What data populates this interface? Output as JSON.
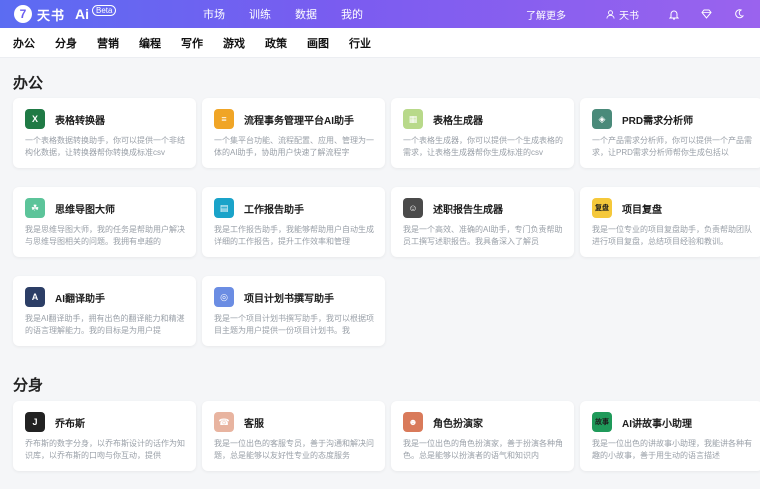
{
  "brand": {
    "mark": "7",
    "name": "天书",
    "ai": "Ai",
    "beta": "Beta"
  },
  "topnav": [
    "市场",
    "训练",
    "数据",
    "我的"
  ],
  "header": {
    "learn_more": "了解更多",
    "user": "天书"
  },
  "categories": [
    "办公",
    "分身",
    "营销",
    "编程",
    "写作",
    "游戏",
    "政策",
    "画图",
    "行业"
  ],
  "sections": [
    {
      "title": "办公",
      "cards": [
        {
          "name": "表格转换器",
          "desc": "一个表格数据转换助手，你可以提供一个非结构化数据，让转换器帮你转换成标准csv",
          "icon": "excel-icon",
          "color": "#1f7a45",
          "glyph": "X"
        },
        {
          "name": "流程事务管理平台AI助手",
          "desc": "一个集平台功能、流程配置、应用、管理为一体的AI助手，协助用户快速了解流程字",
          "icon": "workflow-icon",
          "color": "#f0a526",
          "glyph": "≡"
        },
        {
          "name": "表格生成器",
          "desc": "一个表格生成器，你可以提供一个生成表格的需求，让表格生成器帮你生成标准的csv",
          "icon": "table-grid-icon",
          "color": "#b8d98a",
          "glyph": "▦"
        },
        {
          "name": "PRD需求分析师",
          "desc": "一个产品需求分析师，你可以提供一个产品需求，让PRD需求分析师帮你生成包括以",
          "icon": "prd-analyst-icon",
          "color": "#4a8a7a",
          "glyph": "◈"
        },
        {
          "name": "思维导图大师",
          "desc": "我是思维导图大师，我的任务是帮助用户解决与思维导图相关的问题。我拥有卓越的",
          "icon": "mindmap-icon",
          "color": "#5cc49a",
          "glyph": "☘"
        },
        {
          "name": "工作报告助手",
          "desc": "我是工作报告助手，我能够帮助用户自动生成详细的工作报告，提升工作效率和管理",
          "icon": "report-icon",
          "color": "#1aa3c9",
          "glyph": "▤"
        },
        {
          "name": "述职报告生成器",
          "desc": "我是一个高效、准确的AI助手，专门负责帮助员工撰写述职报告。我具备深入了解员",
          "icon": "presenter-icon",
          "color": "#4a4a4a",
          "glyph": "☺"
        },
        {
          "name": "项目复盘",
          "desc": "我是一位专业的项目复盘助手，负责帮助团队进行项目复盘，总结项目经验和教训。",
          "icon": "project-review-icon",
          "color": "#f5c83a",
          "glyph": "复盘"
        },
        {
          "name": "AI翻译助手",
          "desc": "我是AI翻译助手，拥有出色的翻译能力和精湛的语言理解能力。我的目标是为用户提",
          "icon": "translate-icon",
          "color": "#2c3e66",
          "glyph": "A"
        },
        {
          "name": "项目计划书撰写助手",
          "desc": "我是一个项目计划书撰写助手，我可以根据项目主题为用户提供一份项目计划书。我",
          "icon": "project-plan-icon",
          "color": "#6b8de3",
          "glyph": "◎"
        }
      ]
    },
    {
      "title": "分身",
      "cards": [
        {
          "name": "乔布斯",
          "desc": "乔布斯的数字分身，以乔布斯设计的话作为知识库，以乔布斯的口吻与你互动，提供",
          "icon": "jobs-avatar-icon",
          "color": "#222222",
          "glyph": "J"
        },
        {
          "name": "客服",
          "desc": "我是一位出色的客服专员，善于沟通和解决问题，总是能够以友好性专业的态度服务",
          "icon": "customer-service-icon",
          "color": "#e8b4a0",
          "glyph": "☎"
        },
        {
          "name": "角色扮演家",
          "desc": "我是一位出色的角色扮演家，善于扮演各种角色。总是能够以扮演者的语气和知识内",
          "icon": "role-play-icon",
          "color": "#d97a5a",
          "glyph": "☻"
        },
        {
          "name": "AI讲故事小助理",
          "desc": "我是一位出色的讲故事小助理，我能讲各种有趣的小故事，善于用生动的语言描述",
          "icon": "story-icon",
          "color": "#1f9a5a",
          "glyph": "故事"
        }
      ]
    }
  ]
}
